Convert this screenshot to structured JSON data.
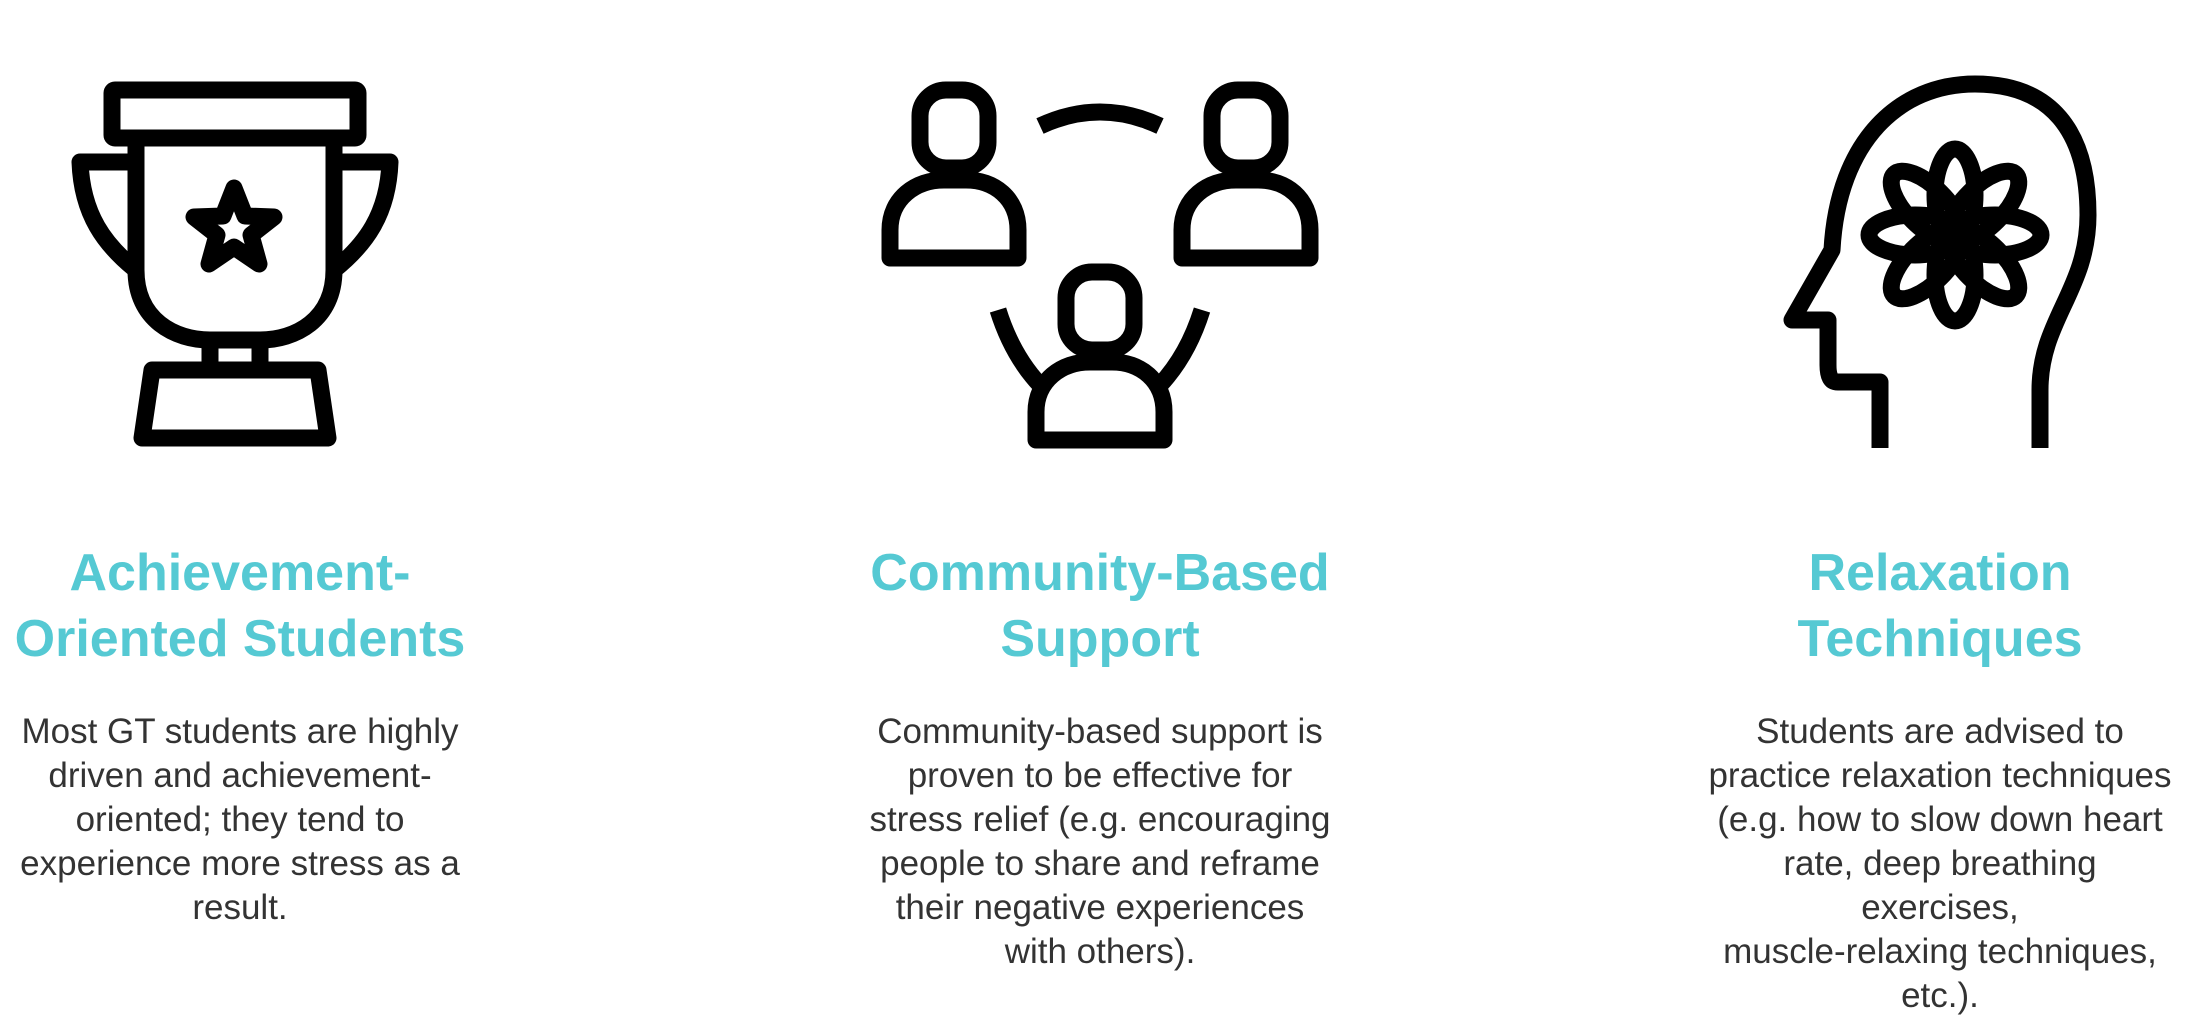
{
  "colors": {
    "title": "#55c9d3",
    "body": "#333333",
    "icon": "#000000"
  },
  "columns": [
    {
      "icon": "trophy-icon",
      "title_lines": [
        "Achievement-",
        "Oriented Students"
      ],
      "body_lines": [
        "Most GT students are highly",
        "driven and achievement-",
        "oriented; they tend to",
        "experience more stress as a",
        "result."
      ]
    },
    {
      "icon": "community-icon",
      "title_lines": [
        "Community-Based",
        "Support"
      ],
      "body_lines": [
        "Community-based support is",
        "proven to be effective for",
        "stress relief (e.g. encouraging",
        "people to share and reframe",
        "their negative experiences",
        "with others)."
      ]
    },
    {
      "icon": "mind-relaxation-icon",
      "title_lines": [
        "Relaxation",
        "Techniques"
      ],
      "body_lines": [
        "Students are advised to",
        "practice relaxation techniques",
        "(e.g. how to slow down heart",
        "rate, deep breathing exercises,",
        "muscle-relaxing techniques,",
        "etc.)."
      ]
    }
  ]
}
